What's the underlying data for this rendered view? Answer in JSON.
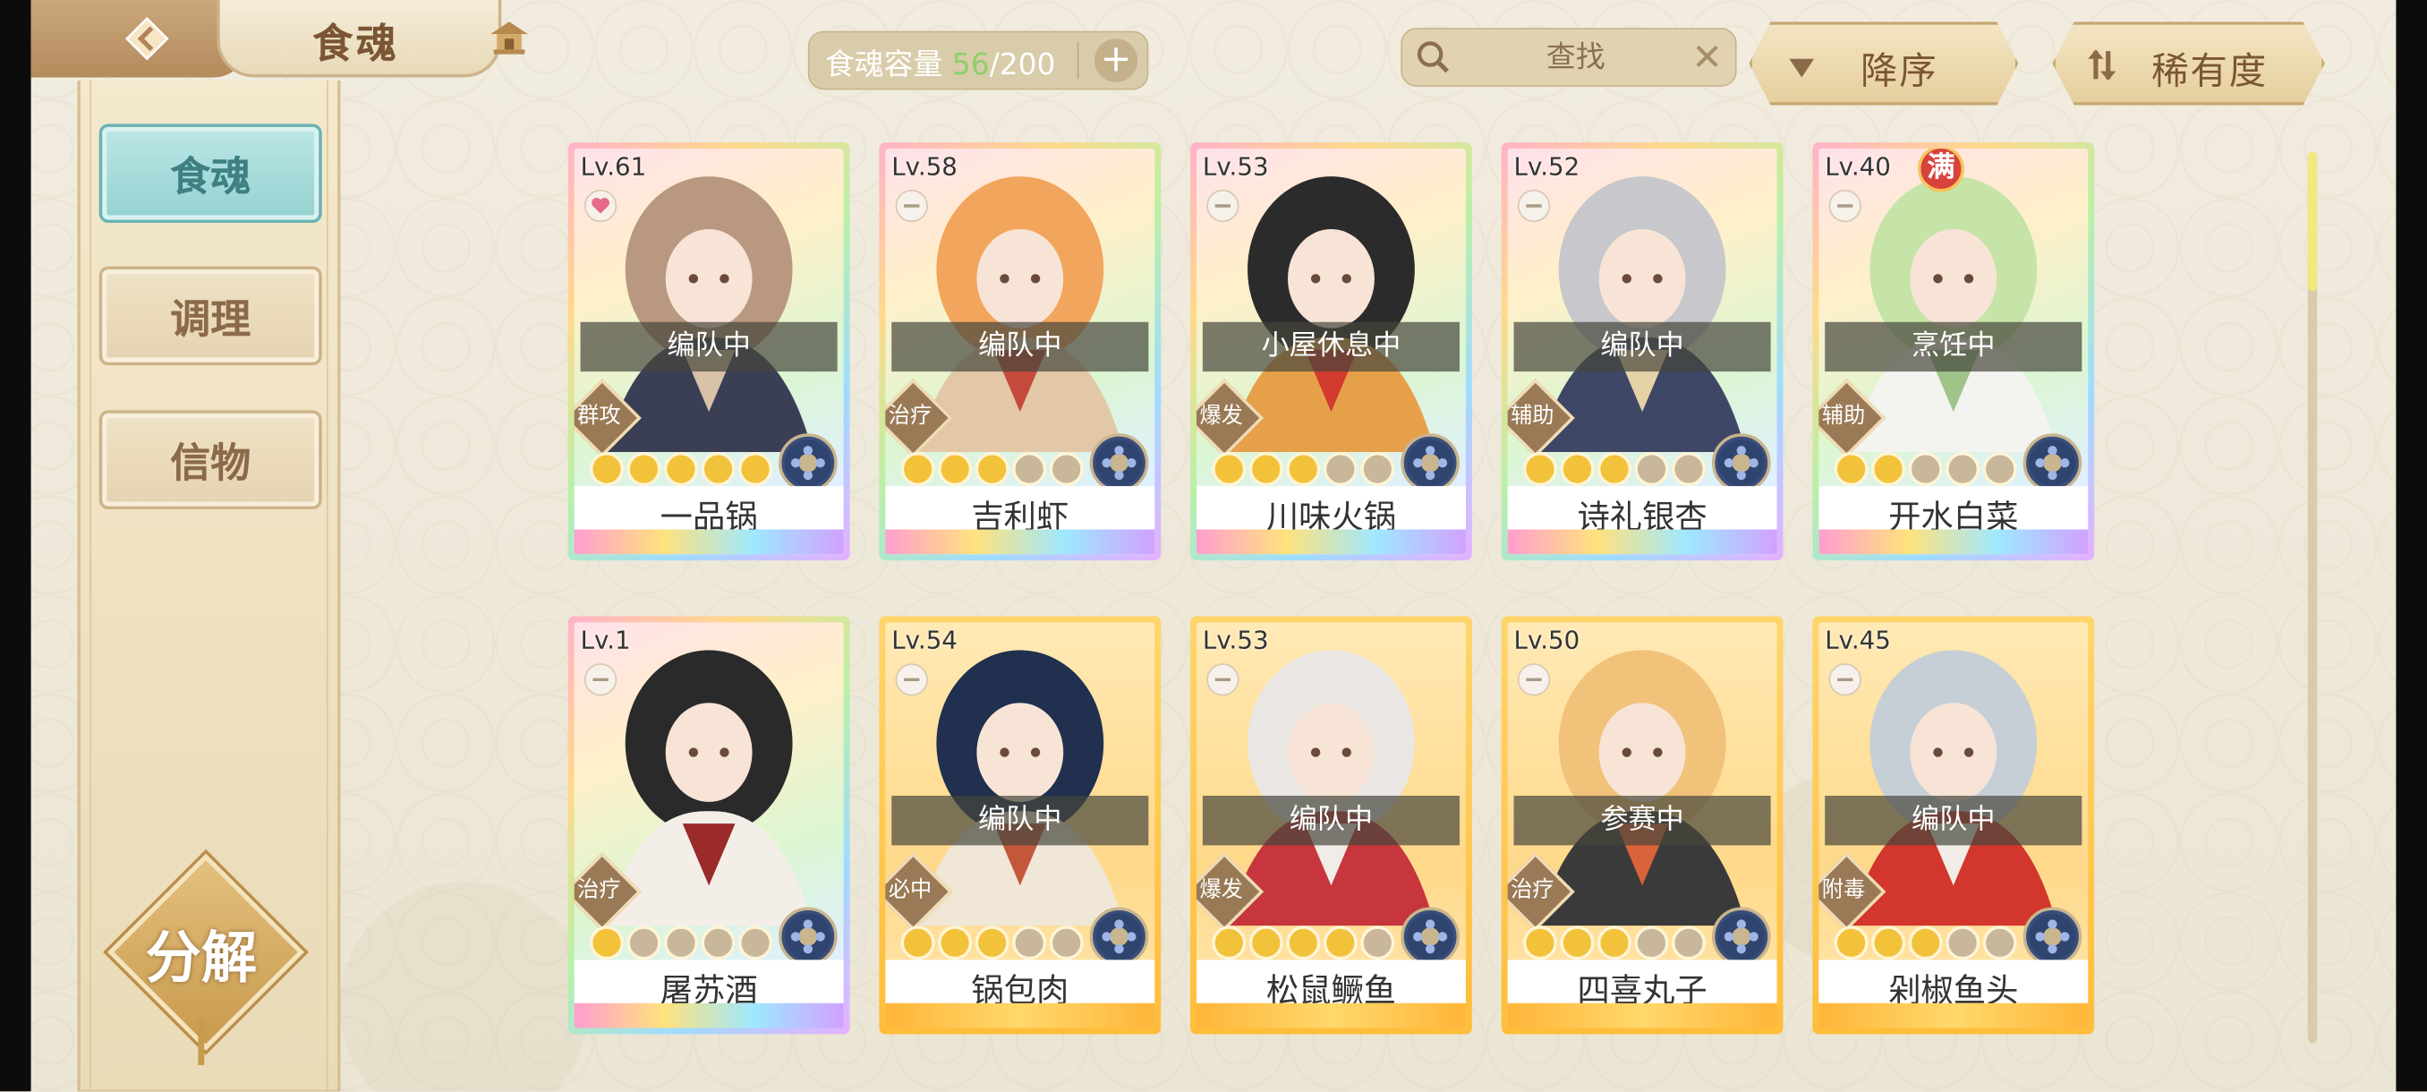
{
  "header": {
    "title": "食魂",
    "capacity_label": "食魂容量",
    "capacity_current": "56",
    "capacity_max": "/200",
    "search_placeholder": "查找",
    "sort_order": "降序",
    "sort_field": "稀有度"
  },
  "sidebar": {
    "items": [
      {
        "label": "食魂",
        "active": true
      },
      {
        "label": "调理",
        "active": false
      },
      {
        "label": "信物",
        "active": false
      }
    ],
    "decompose_label": "分解"
  },
  "cards": [
    {
      "level": "Lv.61",
      "name": "一品锅",
      "status": "编队中",
      "role": "群攻",
      "stars": 5,
      "rarity": "UR",
      "full": false
    },
    {
      "level": "Lv.58",
      "name": "吉利虾",
      "status": "编队中",
      "role": "治疗",
      "stars": 3,
      "rarity": "UR",
      "full": false
    },
    {
      "level": "Lv.53",
      "name": "川味火锅",
      "status": "小屋休息中",
      "role": "爆发",
      "stars": 3,
      "rarity": "UR",
      "full": false
    },
    {
      "level": "Lv.52",
      "name": "诗礼银杏",
      "status": "编队中",
      "role": "辅助",
      "stars": 3,
      "rarity": "UR",
      "full": false
    },
    {
      "level": "Lv.40",
      "name": "开水白菜",
      "status": "烹饪中",
      "role": "辅助",
      "stars": 2,
      "rarity": "UR",
      "full": true,
      "full_label": "满"
    },
    {
      "level": "Lv.1",
      "name": "屠苏酒",
      "status": "",
      "role": "治疗",
      "stars": 1,
      "rarity": "UR",
      "full": false
    },
    {
      "level": "Lv.54",
      "name": "锅包肉",
      "status": "编队中",
      "role": "必中",
      "stars": 3,
      "rarity": "SR",
      "full": false
    },
    {
      "level": "Lv.53",
      "name": "松鼠鳜鱼",
      "status": "编队中",
      "role": "爆发",
      "stars": 4,
      "rarity": "SR",
      "full": false
    },
    {
      "level": "Lv.50",
      "name": "四喜丸子",
      "status": "参赛中",
      "role": "治疗",
      "stars": 3,
      "rarity": "SR",
      "full": false
    },
    {
      "level": "Lv.45",
      "name": "剁椒鱼头",
      "status": "编队中",
      "role": "附毒",
      "stars": 3,
      "rarity": "SR",
      "full": false
    }
  ],
  "colors": {
    "accent_gold": "#c89a4e",
    "star_active": "#f2c23a",
    "star_inactive": "#c8b79a",
    "capacity_current": "#8fcf6a"
  }
}
